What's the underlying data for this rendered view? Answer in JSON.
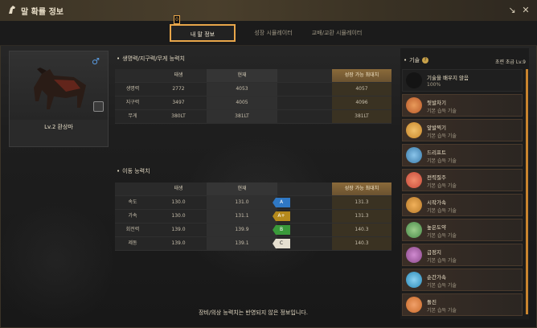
{
  "window": {
    "title": "말 확률 정보",
    "restore_icon": "↘",
    "close_icon": "✕"
  },
  "tabs": {
    "badge": "0",
    "items": [
      {
        "label": "내 말 정보"
      },
      {
        "label": "성장 시뮬레이터"
      },
      {
        "label": "교배/교환 시뮬레이터"
      }
    ]
  },
  "horse": {
    "gender_symbol": "♂",
    "name": "Lv.2 환상마"
  },
  "stats_section": {
    "title": "생명력/지구력/무게 능력치",
    "headers": [
      "",
      "태생",
      "현재",
      "",
      "성장 가능 최대치"
    ],
    "rows": [
      {
        "label": "생명력",
        "base": "2772",
        "current": "4053",
        "max": "4057"
      },
      {
        "label": "지구력",
        "base": "3497",
        "current": "4005",
        "max": "4096"
      },
      {
        "label": "무게",
        "base": "380LT",
        "current": "381LT",
        "max": "381LT"
      }
    ]
  },
  "move_section": {
    "title": "이동 능력치",
    "headers": [
      "",
      "태생",
      "현재",
      "",
      "성장 가능 최대치"
    ],
    "rows": [
      {
        "label": "속도",
        "base": "130.0",
        "current": "131.0",
        "grade": "A",
        "grade_color": "#2f78c4",
        "max": "131.3"
      },
      {
        "label": "가속",
        "base": "130.0",
        "current": "131.1",
        "grade": "A+",
        "grade_color": "#b58a1c",
        "max": "131.3"
      },
      {
        "label": "회전력",
        "base": "139.0",
        "current": "139.9",
        "grade": "B",
        "grade_color": "#3a9a3a",
        "max": "140.3"
      },
      {
        "label": "제동",
        "base": "139.0",
        "current": "139.1",
        "grade": "C",
        "grade_color": "#e6e0d0",
        "max": "140.3"
      }
    ]
  },
  "bottom_note": "장비/의상 능력치는 반영되지 않은 정보입니다.",
  "skills": {
    "title": "기술",
    "help_icon": "?",
    "level": "초련 초급 Lv.9",
    "items": [
      {
        "name": "기술을 배우지 않음",
        "desc": "100%",
        "icon": "empty-slot-icon",
        "color": "#1a1a1a"
      },
      {
        "name": "뒷발차기",
        "desc": "기본 습득 기술",
        "icon": "kick-icon",
        "color": "#b85a2a"
      },
      {
        "name": "앞발찍기",
        "desc": "기본 습득 기술",
        "icon": "stomp-icon",
        "color": "#c8862a"
      },
      {
        "name": "드리프트",
        "desc": "기본 습득 기술",
        "icon": "drift-icon",
        "color": "#3a7aa8"
      },
      {
        "name": "전력질주",
        "desc": "기본 습득 기술",
        "icon": "sprint-icon",
        "color": "#c84a3a"
      },
      {
        "name": "시작가속",
        "desc": "기본 습득 기술",
        "icon": "start-accel-icon",
        "color": "#b87a2a"
      },
      {
        "name": "높은도약",
        "desc": "기본 습득 기술",
        "icon": "high-jump-icon",
        "color": "#4a8a4a"
      },
      {
        "name": "급정지",
        "desc": "기본 습득 기술",
        "icon": "sudden-stop-icon",
        "color": "#8a4a8a"
      },
      {
        "name": "순간가속",
        "desc": "기본 습득 기술",
        "icon": "instant-accel-icon",
        "color": "#2a8ab8"
      },
      {
        "name": "돌진",
        "desc": "기본 습득 기술",
        "icon": "charge-icon",
        "color": "#c86a2a"
      }
    ]
  }
}
